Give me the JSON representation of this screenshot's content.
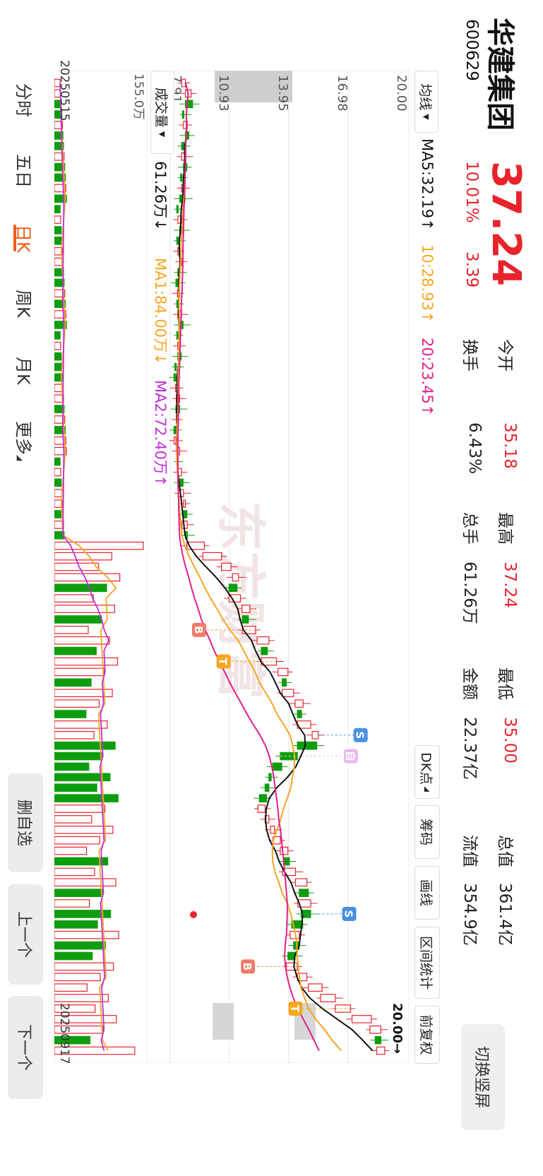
{
  "stock": {
    "name": "华建集团",
    "code": "600629",
    "price": "37.24",
    "pct": "10.01%",
    "change": "3.39"
  },
  "quote": {
    "open_label": "今开",
    "open": "35.18",
    "high_label": "最高",
    "high": "37.24",
    "low_label": "最低",
    "low": "35.00",
    "mcap_label": "总值",
    "mcap": "361.4亿",
    "turn_label": "换手",
    "turn": "6.43%",
    "vol_label": "总手",
    "vol": "61.26万",
    "amt_label": "金额",
    "amt": "22.37亿",
    "float_label": "流值",
    "float": "354.9亿"
  },
  "switch_label": "切换竖屏",
  "indicator_bar": {
    "selector": "均线",
    "ma5": "MA5:32.19↑",
    "ma10": "10:28.93↑",
    "ma20": "20:23.45↑",
    "dk_label": "DK点",
    "chips_label": "筹码",
    "draw_label": "画线",
    "range_label": "区间统计",
    "adjust_label": "前复权"
  },
  "axis": {
    "y_top": "20.00",
    "y_2": "16.98",
    "y_3": "13.95",
    "y_4": "10.93",
    "y_5": "7.91",
    "right_marker": "20.00→",
    "watermark": "东方财富",
    "vol_max": "155.0万",
    "date_start": "20250515",
    "date_end": "20250917"
  },
  "volume_bar": {
    "selector": "成交量",
    "vol": "61.26万↓",
    "ma1": "MA1:84.00万↓",
    "ma2": "MA2:72.40万↑"
  },
  "markers": {
    "self": "自",
    "sell": "S",
    "buy": "B",
    "t": "T"
  },
  "tabs": [
    "分时",
    "五日",
    "日K",
    "周K",
    "月K",
    "更多"
  ],
  "active_tab": 2,
  "side_buttons": {
    "remove": "删自选",
    "prev": "上一个",
    "next": "下一个"
  },
  "colors": {
    "up": "#e8232b",
    "down": "#0e9d0e",
    "ma5": "#111111",
    "ma10": "#f5a623",
    "ma20": "#e0208a",
    "active_tab": "#f05a16"
  },
  "chart_data": {
    "type": "candlestick",
    "title": "",
    "ylim": [
      7.91,
      20.0
    ],
    "x_range": [
      "20250515",
      "20250917"
    ],
    "series": [
      {
        "name": "",
        "close": [
          8.6,
          8.9,
          8.6,
          8.5,
          8.7,
          8.6,
          8.4,
          8.6,
          8.5,
          8.4,
          8.5,
          8.3,
          8.2,
          8.4,
          8.3,
          8.2,
          8.3,
          8.4,
          8.2,
          8.1,
          8.3,
          8.2,
          8.4,
          8.3,
          8.2,
          8.3,
          8.2,
          8.1,
          8.0,
          8.2,
          8.3,
          8.1,
          8.2,
          8.0,
          8.1,
          8.3,
          8.2,
          8.4,
          8.3,
          8.5,
          8.6,
          8.5,
          8.7,
          8.6,
          9.6,
          10.5,
          11.0,
          11.4,
          10.9,
          11.5,
          12.0,
          11.6,
          12.3,
          13.0,
          12.6,
          13.4,
          14.0,
          13.7,
          14.3,
          14.8,
          14.5,
          15.2,
          15.6,
          14.5,
          13.6,
          13.2,
          13.0,
          12.8,
          12.5,
          12.8,
          13.0,
          13.3,
          13.6,
          14.0,
          13.8,
          14.4,
          15.0,
          14.6,
          15.2,
          14.7,
          14.2,
          14.6,
          14.3,
          14.0,
          14.5,
          15.0,
          15.8,
          16.5,
          17.3,
          18.4,
          18.9,
          18.6,
          19.1
        ]
      }
    ],
    "ma_current": {
      "MA5": 32.19,
      "MA10": 28.93,
      "MA20": 23.45
    }
  }
}
